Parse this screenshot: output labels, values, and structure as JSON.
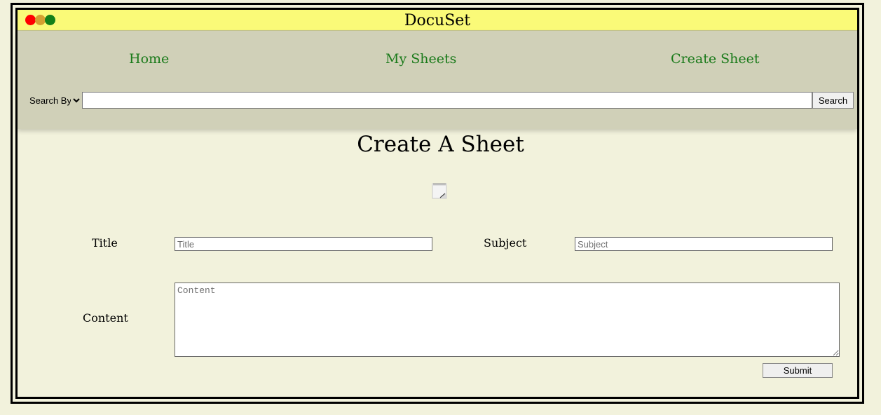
{
  "app": {
    "title": "DocuSet"
  },
  "window_controls": {
    "close_color": "#ff0000",
    "minimize_color": "#d4a030",
    "maximize_color": "#148018"
  },
  "nav": {
    "items": [
      {
        "label": "Home"
      },
      {
        "label": "My Sheets"
      },
      {
        "label": "Create Sheet"
      }
    ],
    "link_color": "#1a7a1a"
  },
  "search": {
    "select_label": "Search By",
    "input_value": "",
    "button_label": "Search"
  },
  "main": {
    "page_title": "Create A Sheet",
    "icon": "notepad-icon"
  },
  "form": {
    "title_label": "Title",
    "title_placeholder": "Title",
    "subject_label": "Subject",
    "subject_placeholder": "Subject",
    "content_label": "Content",
    "content_placeholder": "Content",
    "submit_label": "Submit"
  },
  "colors": {
    "background": "#f2f2dc",
    "titlebar": "#fafa78",
    "navbar": "#d0d0b8"
  }
}
